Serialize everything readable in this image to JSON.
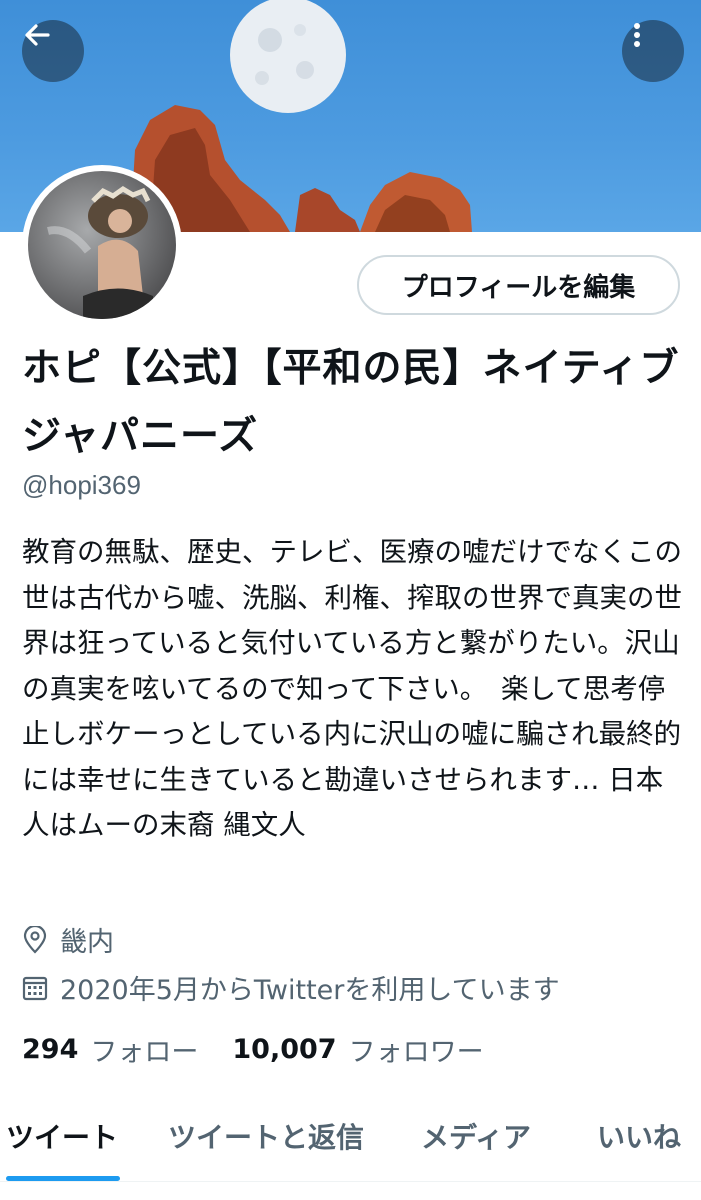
{
  "header": {
    "back_icon": "arrow-left-icon",
    "more_icon": "more-vertical-icon",
    "banner": "moon-over-red-rocks"
  },
  "profile": {
    "edit_button_label": "プロフィールを編集",
    "display_name": "ホピ【公式】【平和の民】ネイティブジャパニーズ",
    "handle": "@hopi369",
    "bio": "教育の無駄、歴史、テレビ、医療の嘘だけでなくこの世は古代から嘘、洗脳、利権、搾取の世界で真実の世界は狂っていると気付いている方と繋がりたい。沢山の真実を呟いてるので知って下さい。　楽して思考停止しボケーっとしている内に沢山の嘘に騙され最終的には幸せに生きていると勘違いさせられます… 日本人はムーの末裔  縄文人",
    "location": "畿内",
    "joined": "2020年5月からTwitterを利用しています",
    "following_count": "294",
    "following_label": "フォロー",
    "followers_count": "10,007",
    "followers_label": "フォロワー"
  },
  "tabs": [
    {
      "label": "ツイート",
      "active": true
    },
    {
      "label": "ツイートと返信",
      "active": false
    },
    {
      "label": "メディア",
      "active": false
    },
    {
      "label": "いいね",
      "active": false
    }
  ],
  "colors": {
    "accent": "#1d9bf0",
    "text_primary": "#0f1419",
    "text_secondary": "#536471",
    "border": "#cfd9de",
    "banner_sky": "#4d9be0"
  }
}
